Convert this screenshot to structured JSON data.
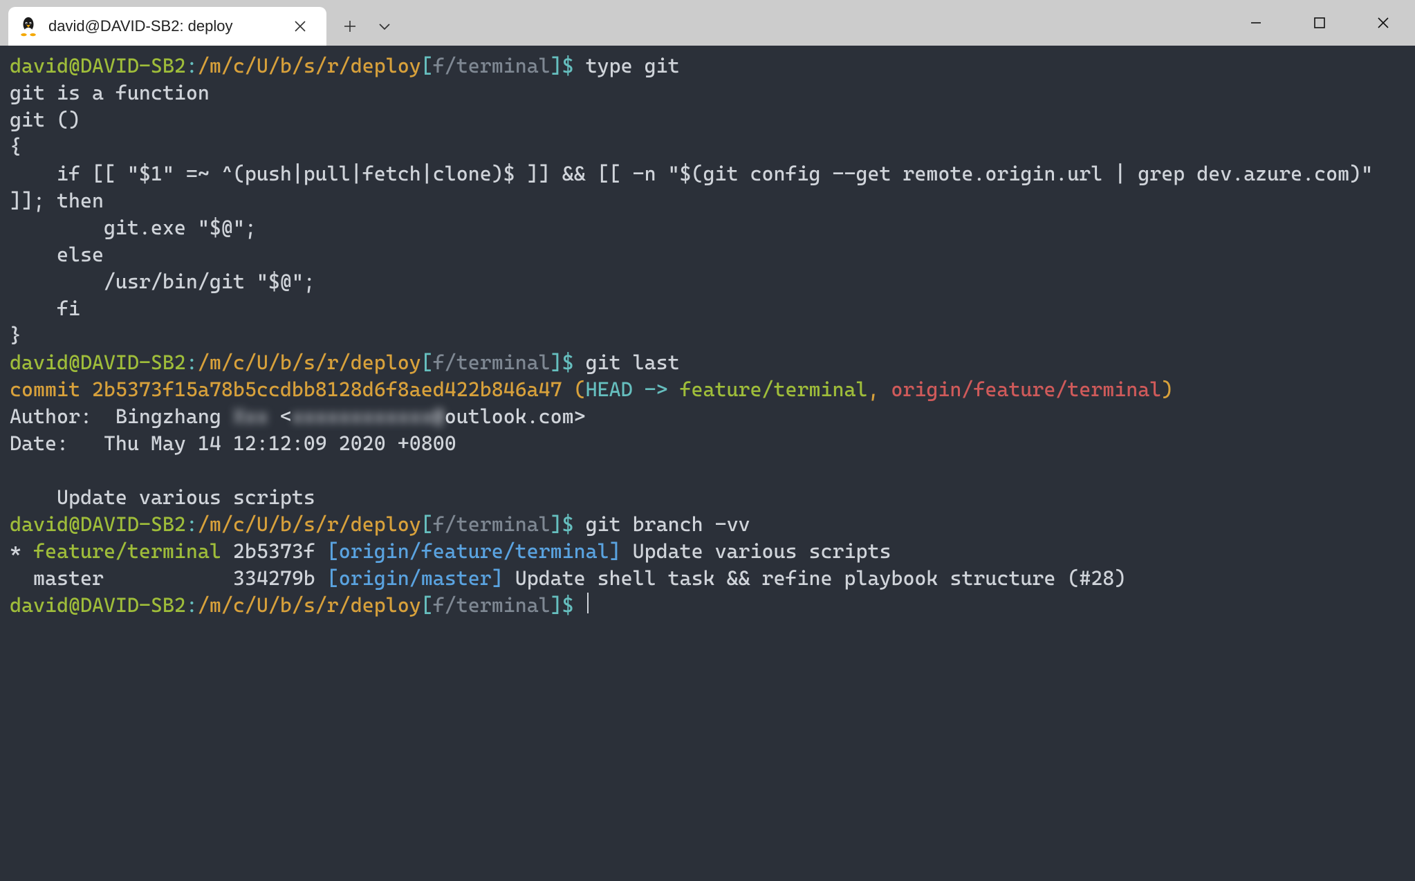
{
  "window": {
    "tab_title": "david@DAVID-SB2: deploy"
  },
  "prompt": {
    "user_host": "david@DAVID-SB2",
    "sep1": ":",
    "path": "/m/c/U/b/s/r/deploy",
    "branch_open": "[",
    "branch": "f/terminal",
    "branch_close": "]",
    "dollar": "$ "
  },
  "cmd1": "type git",
  "out1_l1": "git is a function",
  "out1_l2": "git ()",
  "out1_l3": "{",
  "out1_l4": "    if [[ \"$1\" =~ ^(push|pull|fetch|clone)$ ]] && [[ -n \"$(git config --get remote.origin.url | grep dev.azure.com)\" ]]; then",
  "out1_l5": "        git.exe \"$@\";",
  "out1_l6": "    else",
  "out1_l7": "        /usr/bin/git \"$@\";",
  "out1_l8": "    fi",
  "out1_l9": "}",
  "cmd2": "git last",
  "commit_label": "commit ",
  "commit_hash": "2b5373f15a78b5ccdbb8128d6f8aed422b846a47",
  "commit_open": " (",
  "commit_head": "HEAD -> ",
  "commit_branch_local": "feature/terminal",
  "commit_comma": ", ",
  "commit_branch_remote": "origin/feature/terminal",
  "commit_close": ")",
  "author_prefix": "Author:  Bingzhang ",
  "author_blur1": "Xxx",
  "author_mid": " <",
  "author_blur2": "xxxxxxxxxxxx@",
  "author_suffix": "outlook.com>",
  "date_line": "Date:   Thu May 14 12:12:09 2020 +0800",
  "commit_msg": "    Update various scripts",
  "cmd3": "git branch -vv",
  "b1_pre": "* ",
  "b1_name": "feature/terminal",
  "b1_mid": " 2b5373f ",
  "b1_open": "[",
  "b1_upstream": "origin/feature/terminal",
  "b1_close": "]",
  "b1_msg": " Update various scripts",
  "b2_pre": "  master           334279b ",
  "b2_open": "[",
  "b2_upstream": "origin/master",
  "b2_close": "]",
  "b2_msg": " Update shell task && refine playbook structure (#28)"
}
